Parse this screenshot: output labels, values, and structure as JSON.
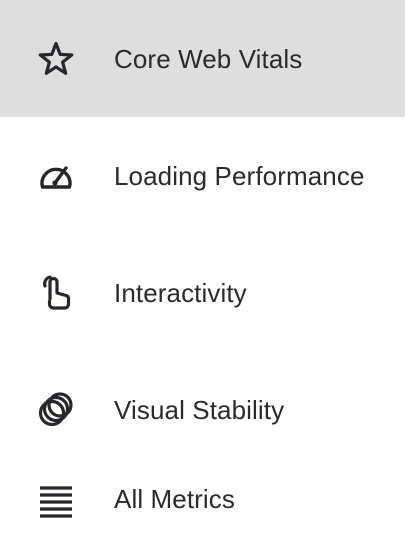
{
  "nav": {
    "items": [
      {
        "label": "Core Web Vitals",
        "icon": "star-icon",
        "active": true
      },
      {
        "label": "Loading Performance",
        "icon": "speedometer-icon",
        "active": false
      },
      {
        "label": "Interactivity",
        "icon": "touch-icon",
        "active": false
      },
      {
        "label": "Visual Stability",
        "icon": "layers-circles-icon",
        "active": false
      },
      {
        "label": "All Metrics",
        "icon": "list-lines-icon",
        "active": false
      }
    ]
  },
  "colors": {
    "active_background": "#dedede",
    "icon_color": "#26262b",
    "text_color": "#2b2b2f"
  }
}
